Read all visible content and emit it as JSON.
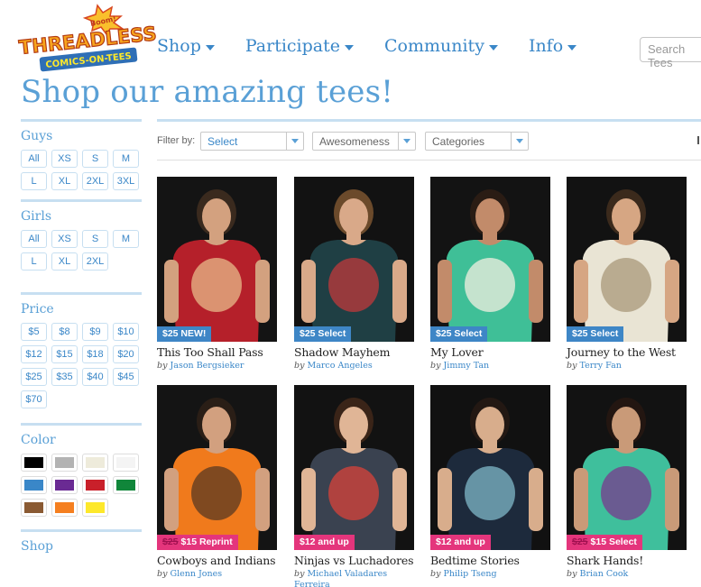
{
  "logo": {
    "top_text": "Boom!",
    "main_text": "THREADLESS",
    "sub_text": "COMICS-ON-TEES"
  },
  "nav": [
    "Shop",
    "Participate",
    "Community",
    "Info"
  ],
  "search": {
    "placeholder": "Search Tees"
  },
  "page_title": "Shop our amazing tees!",
  "sidebar": {
    "guys": {
      "heading": "Guys",
      "sizes": [
        "All",
        "XS",
        "S",
        "M",
        "L",
        "XL",
        "2XL",
        "3XL"
      ]
    },
    "girls": {
      "heading": "Girls",
      "sizes": [
        "All",
        "XS",
        "S",
        "M",
        "L",
        "XL",
        "2XL"
      ]
    },
    "price": {
      "heading": "Price",
      "options": [
        "$5",
        "$8",
        "$9",
        "$10",
        "$12",
        "$15",
        "$18",
        "$20",
        "$25",
        "$35",
        "$40",
        "$45",
        "$70"
      ]
    },
    "color": {
      "heading": "Color",
      "colors": [
        "#000000",
        "#b3b3b3",
        "#eeebdb",
        "#f4f4f4",
        "#3a87c8",
        "#6a2a93",
        "#c9202a",
        "#10863a",
        "#8a5a33",
        "#f57f20",
        "#fde82b"
      ]
    },
    "shop": {
      "heading": "Shop"
    }
  },
  "filter": {
    "label": "Filter by:",
    "select1": "Select",
    "select2": "Awesomeness",
    "select3": "Categories"
  },
  "products": [
    {
      "name": "This Too Shall Pass",
      "by": "by",
      "artist": "Jason Bergsieker",
      "old_price": "",
      "price": "$25 NEW!",
      "tag_color": "blue",
      "bg": "#141414",
      "shirt": "#b5202a",
      "skin": "#d3a17f",
      "hair": "#3a2a1e",
      "print": "#e8b98a"
    },
    {
      "name": "Shadow Mayhem",
      "by": "by",
      "artist": "Marco Angeles",
      "old_price": "",
      "price": "$25 Select",
      "tag_color": "blue",
      "bg": "#121212",
      "shirt": "#1f3f44",
      "skin": "#d9a989",
      "hair": "#6b4a2b",
      "print": "#c0393b"
    },
    {
      "name": "My Lover",
      "by": "by",
      "artist": "Jimmy Tan",
      "old_price": "",
      "price": "$25 Select",
      "tag_color": "blue",
      "bg": "#131313",
      "shirt": "#3fbf97",
      "skin": "#c28b6a",
      "hair": "#2a1c14",
      "print": "#f3efe0"
    },
    {
      "name": "Journey to the West",
      "by": "by",
      "artist": "Terry Fan",
      "old_price": "",
      "price": "$25 Select",
      "tag_color": "blue",
      "bg": "#121212",
      "shirt": "#e9e4d4",
      "skin": "#d6a683",
      "hair": "#3b2a1c",
      "print": "#a8987a"
    },
    {
      "name": "Cowboys and Indians",
      "by": "by",
      "artist": "Glenn Jones",
      "old_price": "$25",
      "price": "$15 Reprint",
      "tag_color": "pink",
      "bg": "#141414",
      "shirt": "#f07a1c",
      "skin": "#d2a07f",
      "hair": "#2a1e16",
      "print": "#5a3a22"
    },
    {
      "name": "Ninjas vs Luchadores",
      "by": "by",
      "artist": "Michael Valadares Ferreira",
      "old_price": "",
      "price": "$12 and up",
      "tag_color": "pink",
      "bg": "#121212",
      "shirt": "#3a4250",
      "skin": "#e0b596",
      "hair": "#3a2418",
      "print": "#d8433a"
    },
    {
      "name": "Bedtime Stories",
      "by": "by",
      "artist": "Philip Tseng",
      "old_price": "",
      "price": "$12 and up",
      "tag_color": "pink",
      "bg": "#111111",
      "shirt": "#1d2a3c",
      "skin": "#d8ad8c",
      "hair": "#231813",
      "print": "#7fb8c8"
    },
    {
      "name": "Shark Hands!",
      "by": "by",
      "artist": "Brian Cook",
      "old_price": "$25",
      "price": "$15 Select",
      "tag_color": "pink",
      "bg": "#121212",
      "shirt": "#3fbf9c",
      "skin": "#c99a78",
      "hair": "#231611",
      "print": "#7a3a8e"
    }
  ]
}
